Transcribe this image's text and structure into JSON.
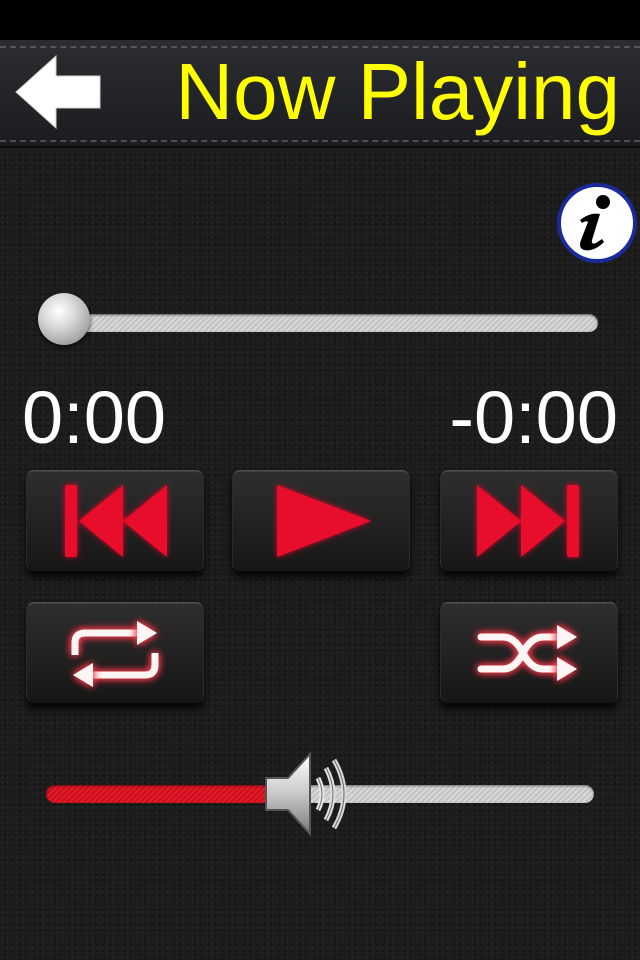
{
  "nav": {
    "title": "Now Playing",
    "back_icon": "arrow-left-icon",
    "title_color": "#ffff00"
  },
  "info": {
    "icon": "info-icon"
  },
  "progress": {
    "value": 0.0
  },
  "time": {
    "elapsed": "0:00",
    "remaining": "-0:00"
  },
  "controls": {
    "previous_icon": "skip-previous-icon",
    "play_icon": "play-icon",
    "next_icon": "skip-next-icon",
    "repeat_icon": "repeat-icon",
    "shuffle_icon": "shuffle-icon",
    "accent_color": "#e8102a"
  },
  "volume": {
    "value": 0.42,
    "icon": "speaker-icon",
    "fill_color": "#e51a2a"
  }
}
